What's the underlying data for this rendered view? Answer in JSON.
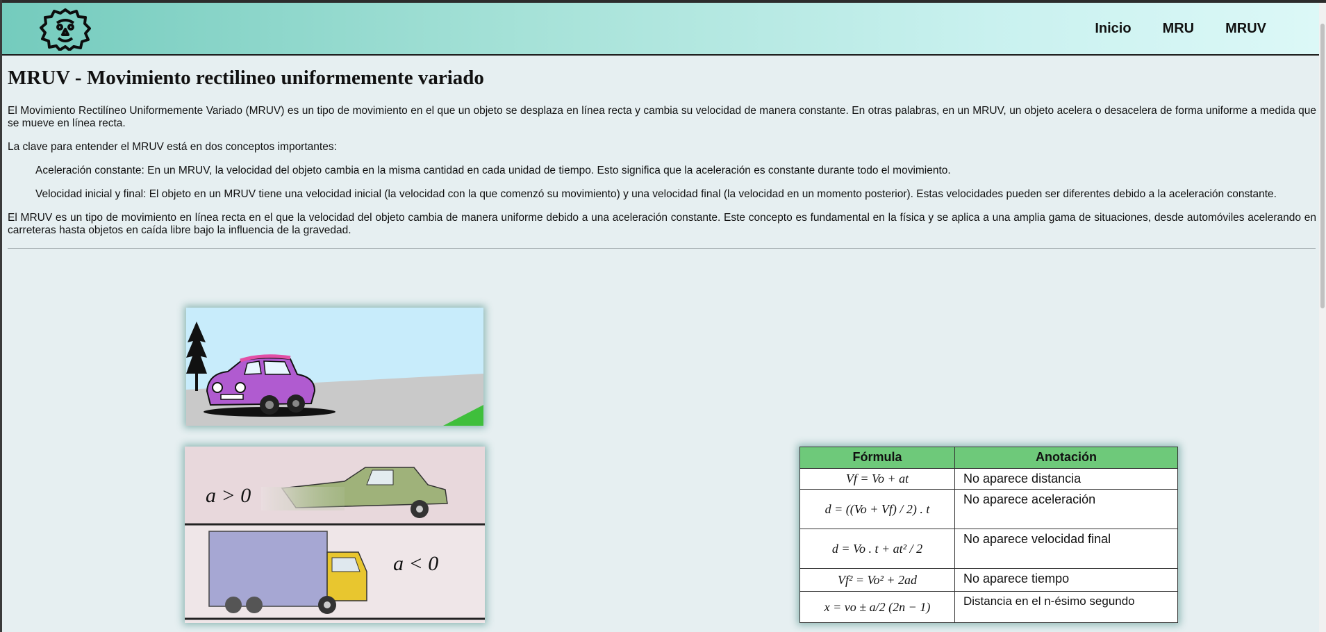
{
  "header": {
    "logo_icon": "lion-head-icon",
    "nav": [
      "Inicio",
      "MRU",
      "MRUV"
    ]
  },
  "main": {
    "title": "MRUV - Movimiento rectilineo uniformemente variado",
    "p1": "El Movimiento Rectilíneo Uniformemente Variado (MRUV) es un tipo de movimiento en el que un objeto se desplaza en línea recta y cambia su velocidad de manera constante. En otras palabras, en un MRUV, un objeto acelera o desacelera de forma uniforme a medida que se mueve en línea recta.",
    "p2": "La clave para entender el MRUV está en dos conceptos importantes:",
    "item1": "Aceleración constante: En un MRUV, la velocidad del objeto cambia en la misma cantidad en cada unidad de tiempo. Esto significa que la aceleración es constante durante todo el movimiento.",
    "item2": "Velocidad inicial y final: El objeto en un MRUV tiene una velocidad inicial (la velocidad con la que comenzó su movimiento) y una velocidad final (la velocidad en un momento posterior). Estas velocidades pueden ser diferentes debido a la aceleración constante.",
    "p3": "El MRUV es un tipo de movimiento en línea recta en el que la velocidad del objeto cambia de manera uniforme debido a una aceleración constante. Este concepto es fundamental en la física y se aplica a una amplia gama de situaciones, desde automóviles acelerando en carreteras hasta objetos en caída libre bajo la influencia de la gravedad."
  },
  "accel_image": {
    "top_label": "a > 0",
    "bottom_label": "a < 0"
  },
  "formula_table": {
    "headers": [
      "Fórmula",
      "Anotación"
    ],
    "rows": [
      {
        "formula": "Vf = Vo + at",
        "note": "No aparece distancia"
      },
      {
        "formula": "d = ((Vo + Vf) / 2) . t",
        "note": "No aparece aceleración"
      },
      {
        "formula": "d = Vo . t + at² / 2",
        "note": "No aparece velocidad final"
      },
      {
        "formula": "Vf² = Vo² + 2ad",
        "note": "No aparece tiempo"
      },
      {
        "formula": "x = vo ± a/2 (2n − 1)",
        "note": "Distancia en el n-ésimo segundo"
      }
    ]
  },
  "colors": {
    "header_start": "#74cbbd",
    "header_end": "#dcf8f7",
    "page_bg": "#e6eff1",
    "table_header": "#6ec97a"
  }
}
